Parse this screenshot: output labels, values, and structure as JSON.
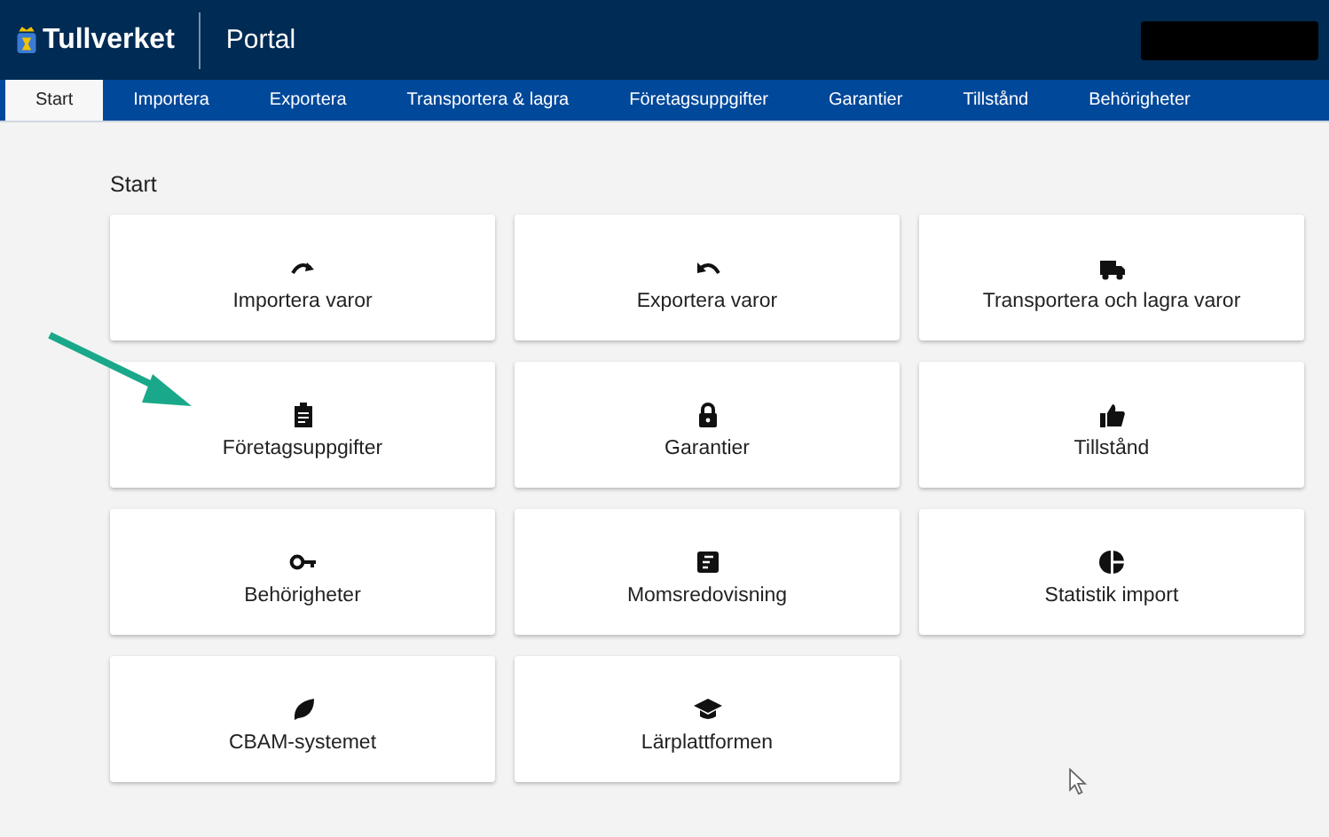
{
  "header": {
    "logo": "Tullverket",
    "title": "Portal"
  },
  "tabs": [
    {
      "label": "Start",
      "selected": true
    },
    {
      "label": "Importera",
      "selected": false
    },
    {
      "label": "Exportera",
      "selected": false
    },
    {
      "label": "Transportera & lagra",
      "selected": false
    },
    {
      "label": "Företagsuppgifter",
      "selected": false
    },
    {
      "label": "Garantier",
      "selected": false
    },
    {
      "label": "Tillstånd",
      "selected": false
    },
    {
      "label": "Behörigheter",
      "selected": false
    }
  ],
  "heading": "Start",
  "cards": [
    {
      "label": "Importera varor",
      "kind": "redo"
    },
    {
      "label": "Exportera varor",
      "kind": "undo"
    },
    {
      "label": "Transportera och lagra varor",
      "kind": "truck"
    },
    {
      "label": "Företagsuppgifter",
      "kind": "clipboard"
    },
    {
      "label": "Garantier",
      "kind": "lock"
    },
    {
      "label": "Tillstånd",
      "kind": "thumb"
    },
    {
      "label": "Behörigheter",
      "kind": "key"
    },
    {
      "label": "Momsredovisning",
      "kind": "doc"
    },
    {
      "label": "Statistik import",
      "kind": "pie"
    },
    {
      "label": "CBAM-systemet",
      "kind": "leaf"
    },
    {
      "label": "Lärplattformen",
      "kind": "cap"
    }
  ]
}
